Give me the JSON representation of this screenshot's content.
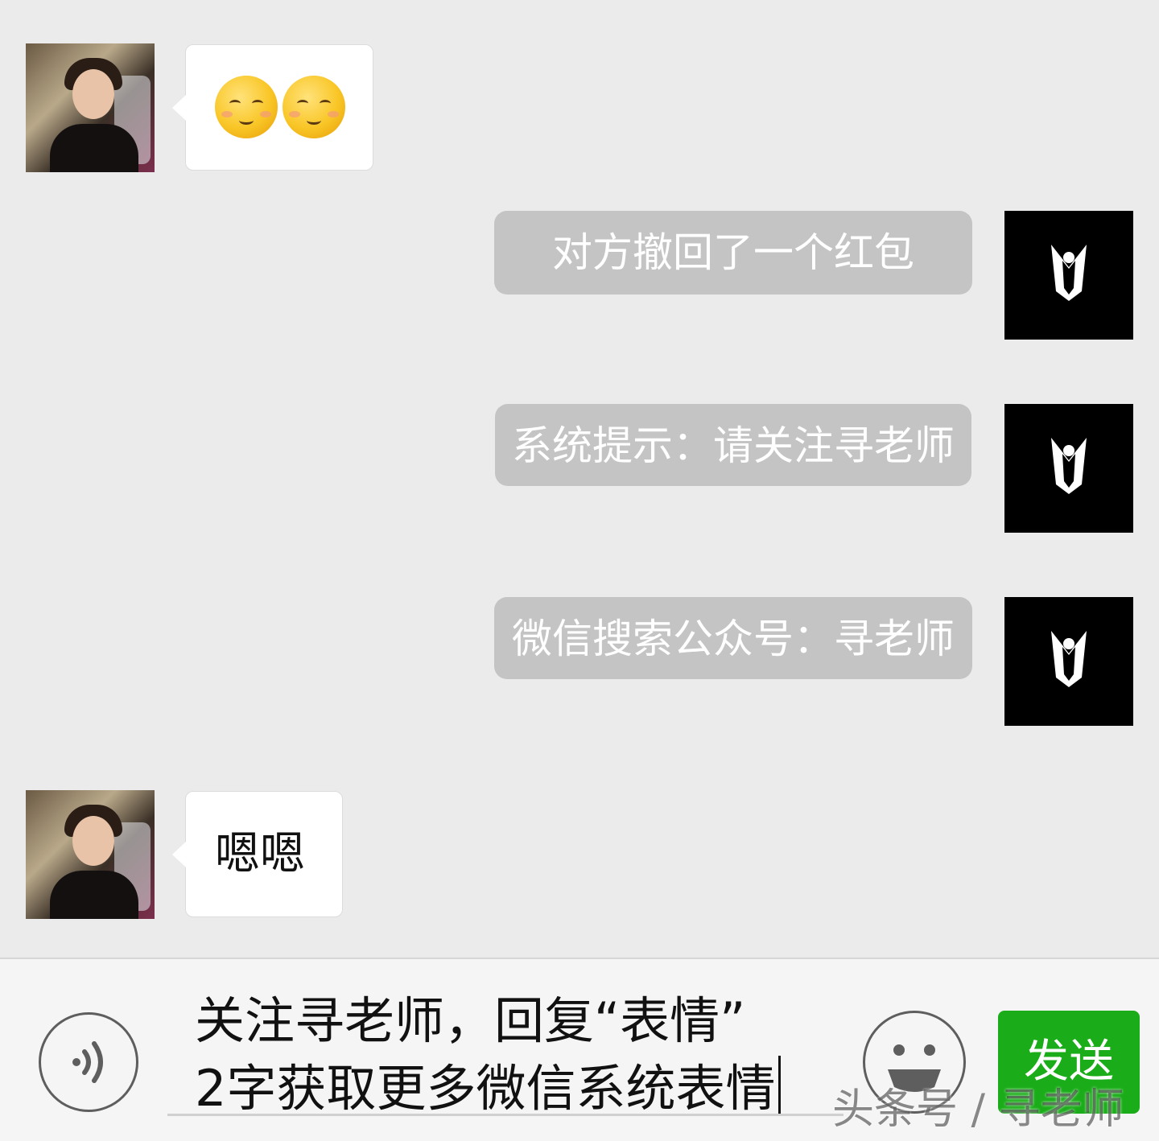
{
  "messages": {
    "reply_text": "嗯嗯",
    "emoji_names": [
      "relieved-face-emoji",
      "relieved-face-emoji"
    ]
  },
  "system_notices": [
    "对方撤回了一个红包",
    "系统提示：请关注寻老师",
    "微信搜索公众号：寻老师"
  ],
  "input_bar": {
    "text_line1": "关注寻老师，回复“表情”",
    "text_line2": "2字获取更多微信系统表情",
    "send_label": "发送",
    "voice_icon": "voice-icon",
    "emoji_icon": "emoji-face-icon"
  },
  "watermark": "头条号 / 寻老师",
  "colors": {
    "background": "#ebebeb",
    "system_bubble": "#c4c4c4",
    "send_button": "#1aad19"
  }
}
